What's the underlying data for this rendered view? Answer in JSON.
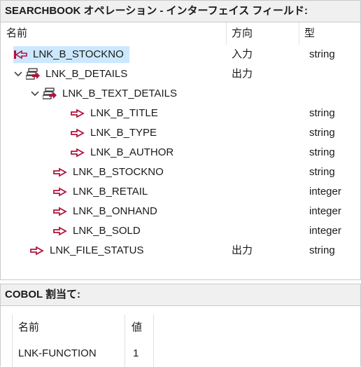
{
  "interface_panel": {
    "title": "SEARCHBOOK オペレーション - インターフェイス フィールド:",
    "columns": {
      "name": "名前",
      "direction": "方向",
      "type": "型"
    },
    "rows": [
      {
        "name": "LNK_B_STOCKNO",
        "direction": "入力",
        "type": "string",
        "icon": "input-arrow-icon",
        "level": 0,
        "expander": "none"
      },
      {
        "name": "LNK_B_DETAILS",
        "direction": "出力",
        "type": "",
        "icon": "group-output-icon",
        "level": 0,
        "expander": "expanded"
      },
      {
        "name": "LNK_B_TEXT_DETAILS",
        "direction": "",
        "type": "",
        "icon": "group-output-icon",
        "level": 1,
        "expander": "expanded"
      },
      {
        "name": "LNK_B_TITLE",
        "direction": "",
        "type": "string",
        "icon": "output-arrow-icon",
        "level": 3,
        "expander": "none"
      },
      {
        "name": "LNK_B_TYPE",
        "direction": "",
        "type": "string",
        "icon": "output-arrow-icon",
        "level": 3,
        "expander": "none"
      },
      {
        "name": "LNK_B_AUTHOR",
        "direction": "",
        "type": "string",
        "icon": "output-arrow-icon",
        "level": 3,
        "expander": "none"
      },
      {
        "name": "LNK_B_STOCKNO",
        "direction": "",
        "type": "string",
        "icon": "output-arrow-icon",
        "level": 2,
        "expander": "none"
      },
      {
        "name": "LNK_B_RETAIL",
        "direction": "",
        "type": "integer",
        "icon": "output-arrow-icon",
        "level": 2,
        "expander": "none"
      },
      {
        "name": "LNK_B_ONHAND",
        "direction": "",
        "type": "integer",
        "icon": "output-arrow-icon",
        "level": 2,
        "expander": "none"
      },
      {
        "name": "LNK_B_SOLD",
        "direction": "",
        "type": "integer",
        "icon": "output-arrow-icon",
        "level": 2,
        "expander": "none"
      },
      {
        "name": "LNK_FILE_STATUS",
        "direction": "出力",
        "type": "string",
        "icon": "output-arrow-icon",
        "level": 1,
        "expander": "none"
      }
    ],
    "selected_row": 0
  },
  "cobol_panel": {
    "title": "COBOL 割当て:",
    "columns": {
      "name": "名前",
      "value": "値"
    },
    "rows": [
      {
        "name": "LNK-FUNCTION",
        "value": "1"
      }
    ]
  },
  "colors": {
    "input_icon": "#b0143c",
    "output_icon": "#b0143c",
    "group_icon_fill": "#b0143c",
    "selection": "#cce8ff"
  }
}
